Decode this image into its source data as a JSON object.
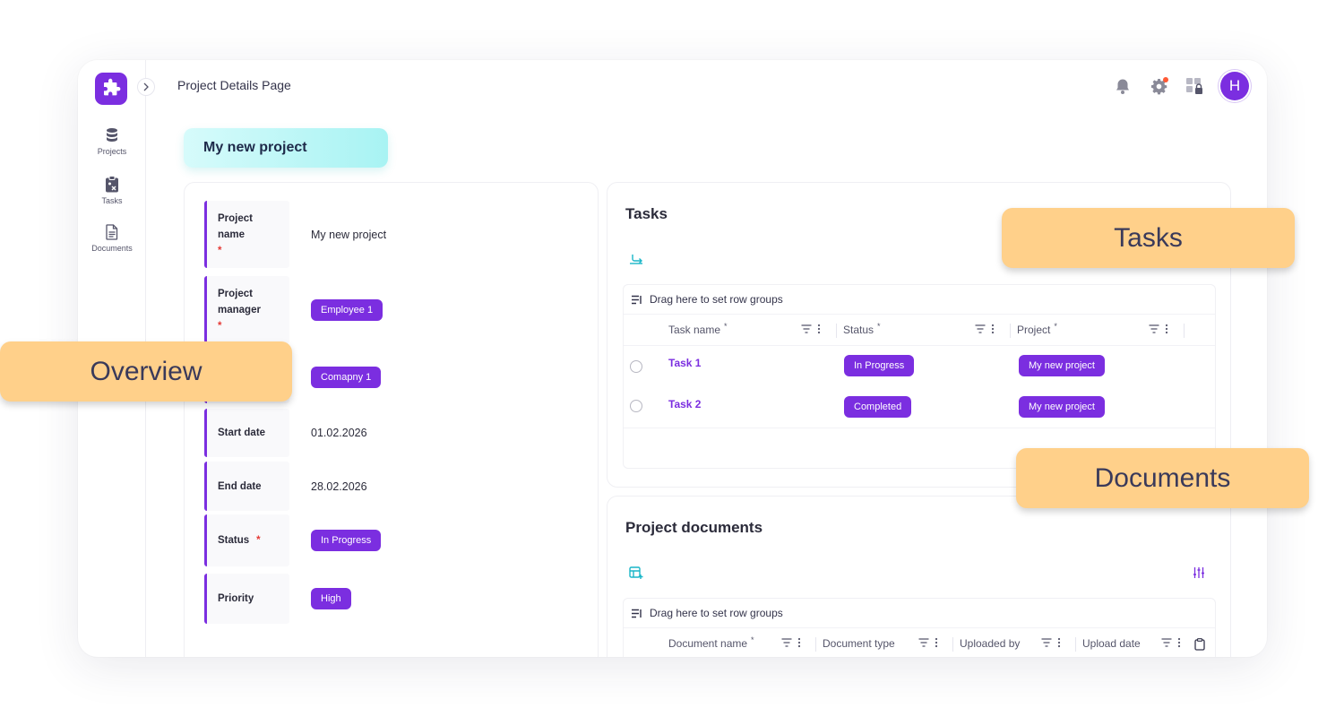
{
  "header": {
    "page_title": "Project Details Page",
    "avatar_initial": "H"
  },
  "sidebar": {
    "items": [
      {
        "label": "Projects",
        "icon": "database-icon"
      },
      {
        "label": "Tasks",
        "icon": "clipboard-icon"
      },
      {
        "label": "Documents",
        "icon": "document-icon"
      }
    ]
  },
  "project_tab": {
    "label": "My new project"
  },
  "overview": {
    "project_name_label": "Project name",
    "project_name_value": "My new project",
    "project_manager_label": "Project manager",
    "project_manager_value": "Employee 1",
    "company_value": "Comapny 1",
    "start_date_label": "Start date",
    "start_date_value": "01.02.2026",
    "end_date_label": "End date",
    "end_date_value": "28.02.2026",
    "status_label": "Status",
    "status_value": "In Progress",
    "priority_label": "Priority",
    "priority_value": "High",
    "required_mark": "*"
  },
  "tasks": {
    "title": "Tasks",
    "group_bar": "Drag here to set row groups",
    "columns": [
      "Task name",
      "Status",
      "Project"
    ],
    "required_mark": "*",
    "rows": [
      {
        "name": "Task 1",
        "status": "In Progress",
        "project": "My new project"
      },
      {
        "name": "Task 2",
        "status": "Completed",
        "project": "My new project"
      }
    ]
  },
  "documents": {
    "title": "Project documents",
    "group_bar": "Drag here to set row groups",
    "columns": [
      "Document name",
      "Document type",
      "Uploaded by",
      "Upload date"
    ],
    "required_mark": "*"
  },
  "callouts": {
    "overview": "Overview",
    "tasks": "Tasks",
    "documents": "Documents"
  },
  "colors": {
    "accent": "#7b2ee0",
    "callout": "#ffd08a",
    "tab_gradient_end": "#a8f3f3",
    "notif_dot": "#ff5a36"
  }
}
